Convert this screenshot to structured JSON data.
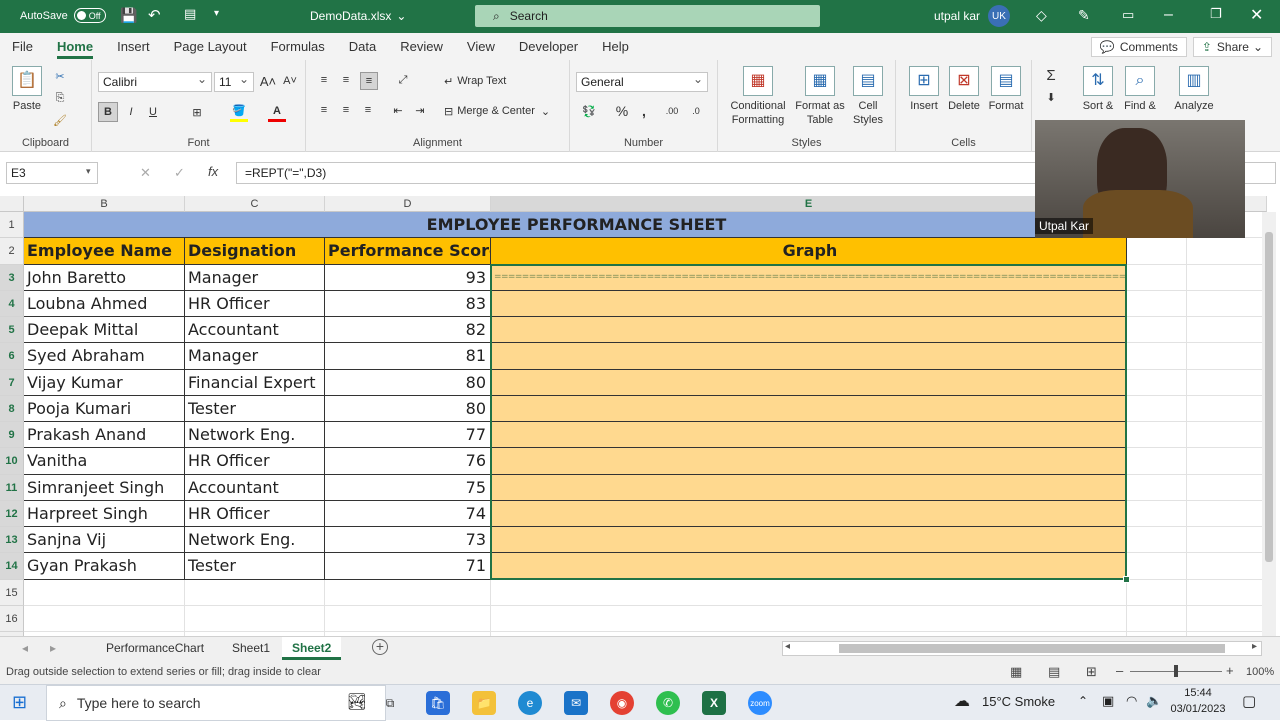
{
  "titlebar": {
    "autosave_label": "AutoSave",
    "autosave_state": "Off",
    "filename": "DemoData.xlsx",
    "search_placeholder": "Search",
    "user_name": "utpal kar",
    "user_initials": "UK"
  },
  "menu": {
    "items": [
      "File",
      "Home",
      "Insert",
      "Page Layout",
      "Formulas",
      "Data",
      "Review",
      "View",
      "Developer",
      "Help"
    ],
    "active": "Home",
    "comments_label": "Comments",
    "share_label": "Share"
  },
  "ribbon": {
    "clipboard": {
      "paste_label": "Paste",
      "group_label": "Clipboard"
    },
    "font": {
      "font_name": "Calibri",
      "font_size": "11",
      "group_label": "Font",
      "bold": "B",
      "italic": "I",
      "underline": "U"
    },
    "alignment": {
      "wrap_text": "Wrap Text",
      "merge_center": "Merge & Center",
      "group_label": "Alignment"
    },
    "number": {
      "format": "General",
      "group_label": "Number"
    },
    "styles": {
      "conditional": "Conditional",
      "conditional2": "Formatting",
      "format_as": "Format as",
      "format_as2": "Table",
      "cell": "Cell",
      "cell2": "Styles",
      "group_label": "Styles"
    },
    "cells": {
      "insert": "Insert",
      "delete": "Delete",
      "format": "Format",
      "group_label": "Cells"
    },
    "editing": {
      "sort": "Sort &",
      "find": "Find &",
      "analyze": "Analyze"
    }
  },
  "formula_bar": {
    "name_box": "E3",
    "formula": "=REPT(\"=\",D3)"
  },
  "columns": [
    "B",
    "C",
    "D",
    "E"
  ],
  "sheet": {
    "title": "EMPLOYEE PERFORMANCE SHEET",
    "headers": [
      "Employee Name",
      "Designation",
      "Performance Score",
      "Graph"
    ],
    "rows": [
      {
        "row": "3",
        "name": "John Baretto",
        "designation": "Manager",
        "score": "93"
      },
      {
        "row": "4",
        "name": "Loubna Ahmed",
        "designation": "HR Officer",
        "score": "83"
      },
      {
        "row": "5",
        "name": "Deepak Mittal",
        "designation": "Accountant",
        "score": "82"
      },
      {
        "row": "6",
        "name": "Syed Abraham",
        "designation": "Manager",
        "score": "81"
      },
      {
        "row": "7",
        "name": "Vijay Kumar",
        "designation": "Financial Expert",
        "score": "80"
      },
      {
        "row": "8",
        "name": "Pooja Kumari",
        "designation": "Tester",
        "score": "80"
      },
      {
        "row": "9",
        "name": "Prakash Anand",
        "designation": "Network Eng.",
        "score": "77"
      },
      {
        "row": "10",
        "name": "Vanitha",
        "designation": "HR Officer",
        "score": "76"
      },
      {
        "row": "11",
        "name": "Simranjeet Singh",
        "designation": "Accountant",
        "score": "75"
      },
      {
        "row": "12",
        "name": "Harpreet Singh",
        "designation": "HR Officer",
        "score": "74"
      },
      {
        "row": "13",
        "name": "Sanjna Vij",
        "designation": "Network Eng.",
        "score": "73"
      },
      {
        "row": "14",
        "name": "Gyan Prakash",
        "designation": "Tester",
        "score": "71"
      }
    ],
    "graph_fill": "==============================================================================================="
  },
  "tabs": {
    "items": [
      "PerformanceChart",
      "Sheet1",
      "Sheet2"
    ],
    "active": "Sheet2"
  },
  "status": {
    "message": "Drag outside selection to extend series or fill; drag inside to clear",
    "zoom": "100%"
  },
  "webcam": {
    "name": "Utpal Kar"
  },
  "taskbar": {
    "search_placeholder": "Type here to search",
    "weather": "15°C  Smoke",
    "time": "15:44",
    "date": "03/01/2023"
  },
  "colors": {
    "excel_green": "#217346",
    "header_yellow": "#ffc000",
    "title_blue": "#8eaadb",
    "graph_fill": "#ffd98f"
  }
}
